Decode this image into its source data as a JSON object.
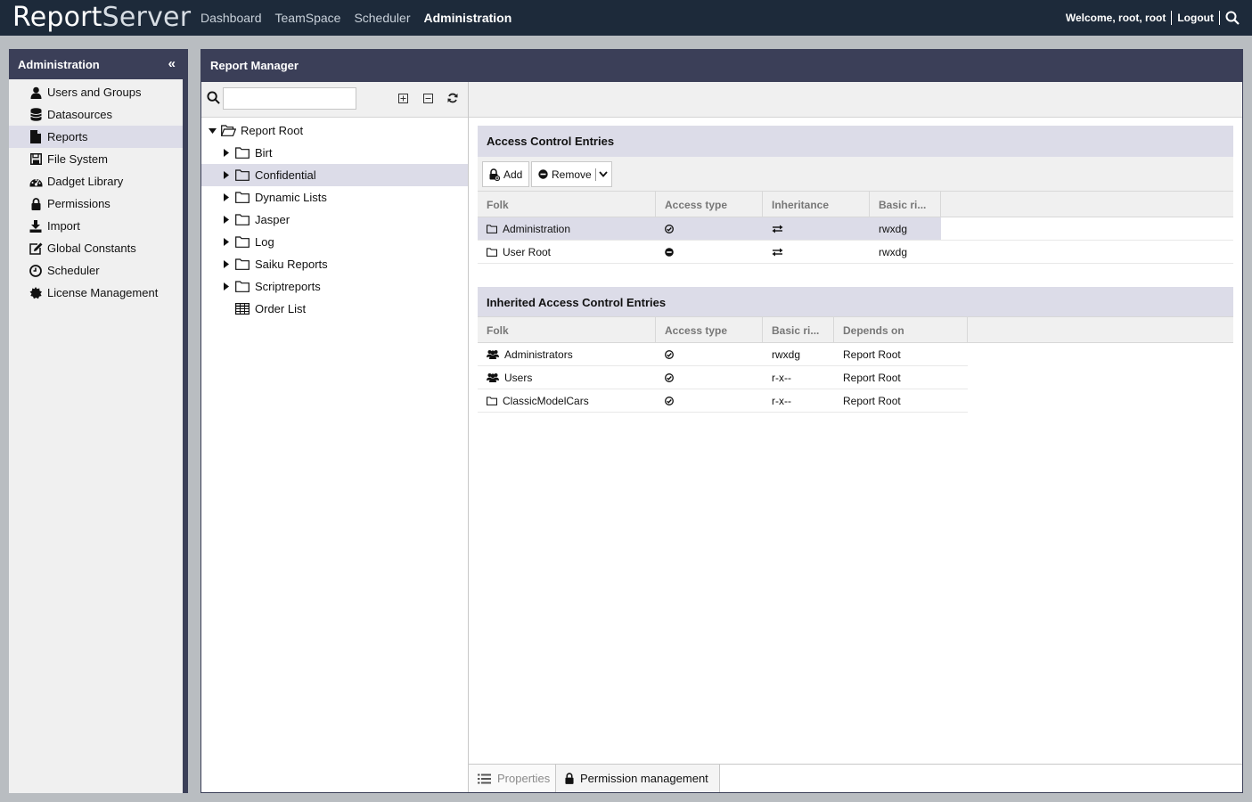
{
  "app": {
    "logo_bold": "Report",
    "logo_light": "Server"
  },
  "nav": {
    "items": [
      "Dashboard",
      "TeamSpace",
      "Scheduler",
      "Administration"
    ],
    "active": "Administration"
  },
  "user": {
    "welcome": "Welcome, root, root",
    "logout": "Logout"
  },
  "admin_panel": {
    "title": "Administration",
    "items": [
      {
        "label": "Users and Groups",
        "icon": "user-icon"
      },
      {
        "label": "Datasources",
        "icon": "database-icon"
      },
      {
        "label": "Reports",
        "icon": "file-icon"
      },
      {
        "label": "File System",
        "icon": "save-icon"
      },
      {
        "label": "Dadget Library",
        "icon": "dashboard-icon"
      },
      {
        "label": "Permissions",
        "icon": "lock-icon"
      },
      {
        "label": "Import",
        "icon": "download-icon"
      },
      {
        "label": "Global Constants",
        "icon": "edit-icon"
      },
      {
        "label": "Scheduler",
        "icon": "clock-icon"
      },
      {
        "label": "License Management",
        "icon": "certificate-icon"
      }
    ],
    "selected": "Reports"
  },
  "report_manager": {
    "title": "Report Manager",
    "search_value": "",
    "tree": {
      "root": "Report Root",
      "children": [
        "Birt",
        "Confidential",
        "Dynamic Lists",
        "Jasper",
        "Log",
        "Saiku Reports",
        "Scriptreports"
      ],
      "leaf": "Order List",
      "selected": "Confidential"
    }
  },
  "ace": {
    "title": "Access Control Entries",
    "add_label": "Add",
    "remove_label": "Remove",
    "columns": [
      "Folk",
      "Access type",
      "Inheritance",
      "Basic ri..."
    ],
    "rows": [
      {
        "folk": "Administration",
        "access": "allow",
        "inheritance": "inherit",
        "rights": "rwxdg"
      },
      {
        "folk": "User Root",
        "access": "deny",
        "inheritance": "inherit",
        "rights": "rwxdg"
      }
    ]
  },
  "inherited": {
    "title": "Inherited Access Control Entries",
    "columns": [
      "Folk",
      "Access type",
      "Basic ri...",
      "Depends on"
    ],
    "rows": [
      {
        "folk": "Administrators",
        "type": "group",
        "access": "allow",
        "rights": "rwxdg",
        "depends": "Report Root"
      },
      {
        "folk": "Users",
        "type": "group",
        "access": "allow",
        "rights": "r-x--",
        "depends": "Report Root"
      },
      {
        "folk": "ClassicModelCars",
        "type": "folder",
        "access": "allow",
        "rights": "r-x--",
        "depends": "Report Root"
      }
    ]
  },
  "bottom_tabs": {
    "properties": "Properties",
    "permissions": "Permission management",
    "active": "Permission management"
  }
}
